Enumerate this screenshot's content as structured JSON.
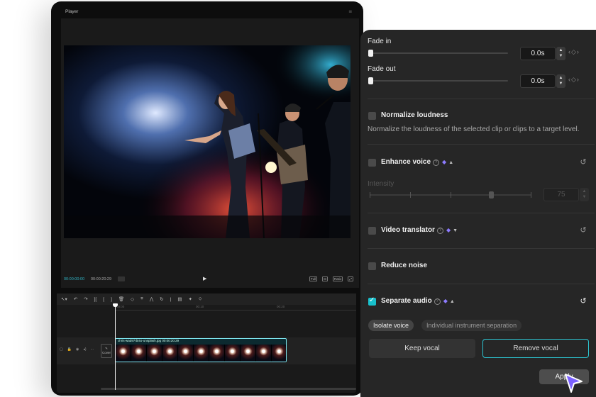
{
  "player": {
    "title": "Player",
    "current_time": "00:00:00:00",
    "total_time": "00:00:20:29",
    "ratio_labels": [
      "Full",
      "Ratio"
    ]
  },
  "timeline": {
    "ruler": [
      "00:00",
      "00:10",
      "00:20"
    ],
    "cover_label": "Cover",
    "clip_name": "chris-wad97rbl4o-unsplash.jpg",
    "clip_duration": "00:00:20:29"
  },
  "panel": {
    "fade_in": {
      "label": "Fade in",
      "value": "0.0s"
    },
    "fade_out": {
      "label": "Fade out",
      "value": "0.0s"
    },
    "normalize": {
      "title": "Normalize loudness",
      "checked": false,
      "description": "Normalize the loudness of the selected clip or clips to a target level."
    },
    "enhance": {
      "title": "Enhance voice",
      "checked": false,
      "intensity_label": "Intensity",
      "intensity_value": "75",
      "intensity_level": 0.75
    },
    "translator": {
      "title": "Video translator",
      "checked": false
    },
    "reduce_noise": {
      "title": "Reduce noise",
      "checked": false
    },
    "separate": {
      "title": "Separate audio",
      "checked": true,
      "tabs": [
        "Isolate voice",
        "Individual instrument separation"
      ],
      "active_tab": "Isolate voice",
      "keep_label": "Keep vocal",
      "remove_label": "Remove vocal"
    },
    "apply_label": "Apply"
  },
  "colors": {
    "accent": "#18c0cc",
    "panel_bg": "#262626",
    "gem": "#8d7bff",
    "cursor": "#7b61ff"
  },
  "icons": [
    "menu-icon",
    "play-icon",
    "select-tool-icon",
    "undo-icon",
    "redo-icon",
    "split-icon",
    "delete-icon",
    "crop-icon",
    "mirror-icon",
    "rotate-icon",
    "help-icon",
    "premium-gem-icon",
    "caret-icon",
    "reset-icon",
    "keyframe-icon",
    "cursor-icon"
  ]
}
